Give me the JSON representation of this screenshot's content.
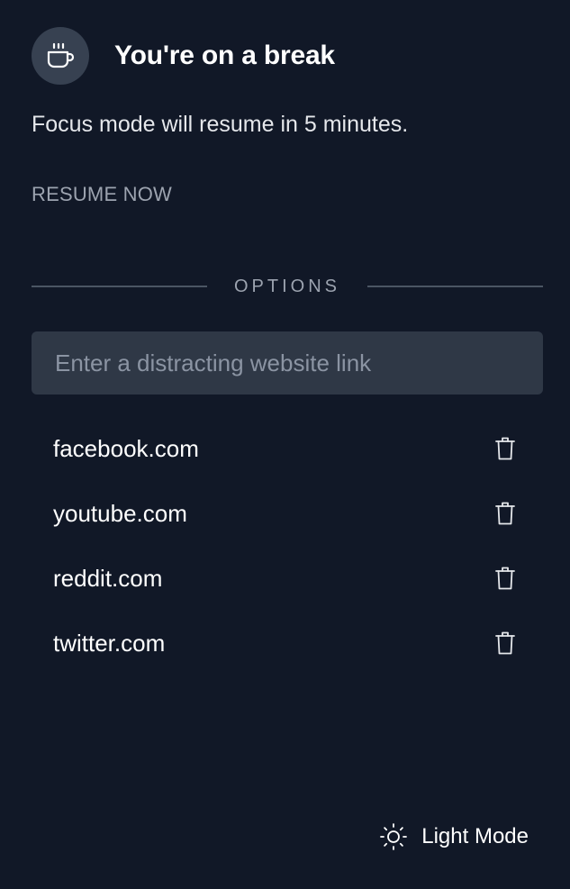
{
  "header": {
    "icon": "coffee-cup-icon",
    "title": "You're on a break"
  },
  "status": {
    "message": "Focus mode will resume in 5 minutes."
  },
  "actions": {
    "resume_label": "RESUME NOW"
  },
  "options": {
    "divider_label": "OPTIONS",
    "input_placeholder": "Enter a distracting website link",
    "input_value": ""
  },
  "sites": [
    {
      "label": "facebook.com",
      "icon": "trash-icon"
    },
    {
      "label": "youtube.com",
      "icon": "trash-icon"
    },
    {
      "label": "reddit.com",
      "icon": "trash-icon"
    },
    {
      "label": "twitter.com",
      "icon": "trash-icon"
    }
  ],
  "footer": {
    "theme_toggle_label": "Light Mode",
    "theme_toggle_icon": "sun-icon"
  },
  "colors": {
    "background": "#111827",
    "avatar_background": "#374151",
    "input_background": "#2f3846",
    "muted_text": "#9ca3af",
    "primary_text": "#ffffff"
  }
}
